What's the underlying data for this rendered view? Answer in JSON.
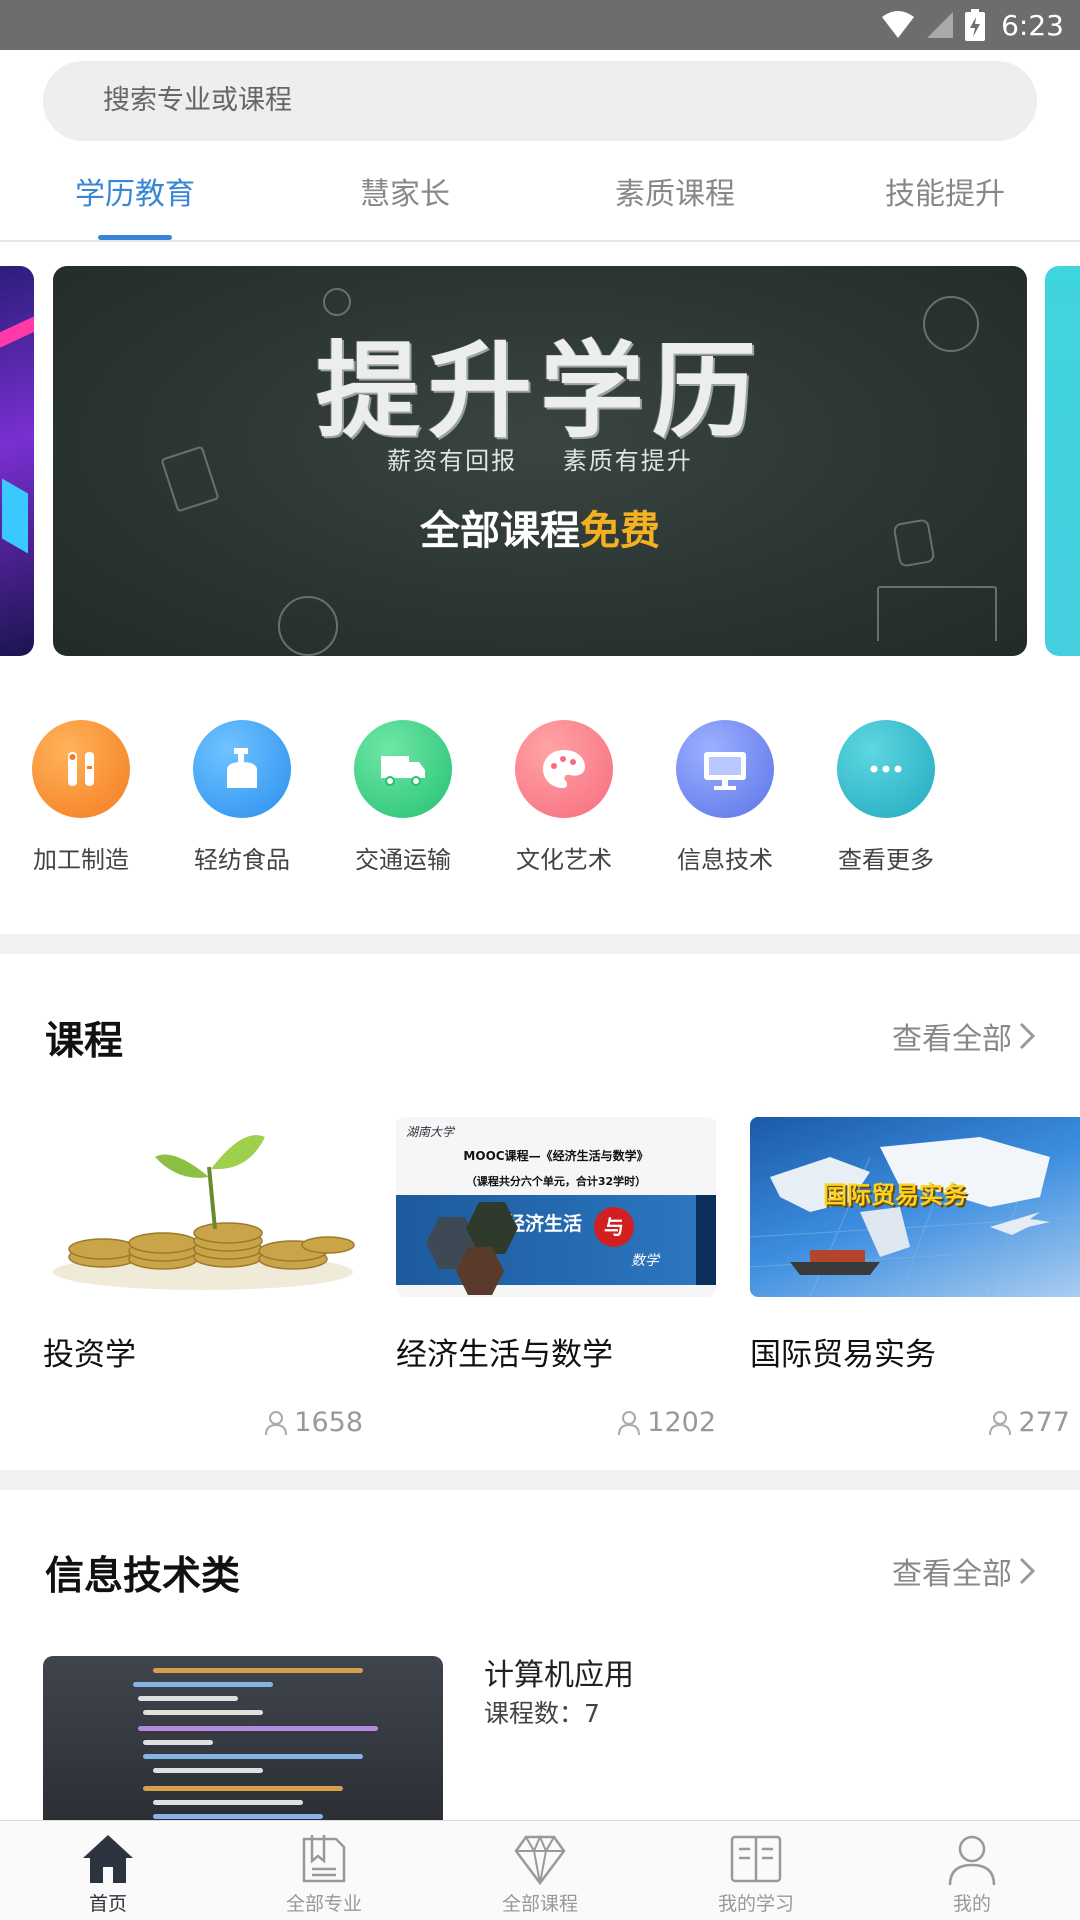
{
  "status_bar": {
    "time": "6:23",
    "icons": [
      "wifi-icon",
      "signal-icon",
      "battery-icon"
    ]
  },
  "search": {
    "placeholder": "搜索专业或课程"
  },
  "tabs": [
    {
      "label": "学历教育",
      "active": true
    },
    {
      "label": "慧家长",
      "active": false
    },
    {
      "label": "素质课程",
      "active": false
    },
    {
      "label": "技能提升",
      "active": false
    }
  ],
  "banner": {
    "title": "提升学历",
    "subtitle_left": "薪资有回报",
    "subtitle_right": "素质有提升",
    "free_line_prefix": "全部课程",
    "free_line_highlight": "免费"
  },
  "categories": [
    {
      "label": "加工制造",
      "icon": "tools-icon",
      "color": "#f7942a"
    },
    {
      "label": "轻纺食品",
      "icon": "bottle-icon",
      "color": "#3fa7f5"
    },
    {
      "label": "交通运输",
      "icon": "truck-icon",
      "color": "#39d085"
    },
    {
      "label": "文化艺术",
      "icon": "palette-icon",
      "color": "#fb7a86"
    },
    {
      "label": "信息技术",
      "icon": "monitor-icon",
      "color": "#6d86ef"
    },
    {
      "label": "查看更多",
      "icon": "more-icon",
      "color": "#2fb8c8"
    }
  ],
  "courses_section": {
    "title": "课程",
    "view_all": "查看全部",
    "items": [
      {
        "title": "投资学",
        "count": "1658"
      },
      {
        "title": "经济生活与数学",
        "count": "1202",
        "thumb_header": "湖南大学",
        "thumb_title": "MOOC课程—《经济生活与数学》",
        "thumb_sub": "（课程共分六个单元，合计32学时）",
        "thumb_banner": "经济生活",
        "thumb_badge": "与",
        "thumb_math": "数学"
      },
      {
        "title": "国际贸易实务",
        "count": "277",
        "thumb_text": "国际贸易实务"
      }
    ]
  },
  "info_section": {
    "title": "信息技术类",
    "view_all": "查看全部",
    "item": {
      "name": "计算机应用",
      "count": "课程数：7"
    }
  },
  "bottom_nav": [
    {
      "label": "首页",
      "active": true
    },
    {
      "label": "全部专业",
      "active": false
    },
    {
      "label": "全部课程",
      "active": false
    },
    {
      "label": "我的学习",
      "active": false
    },
    {
      "label": "我的",
      "active": false
    }
  ],
  "colors": {
    "accent": "#3a86d6",
    "nav_active": "#2d3440",
    "banner_highlight": "#f4b221"
  }
}
